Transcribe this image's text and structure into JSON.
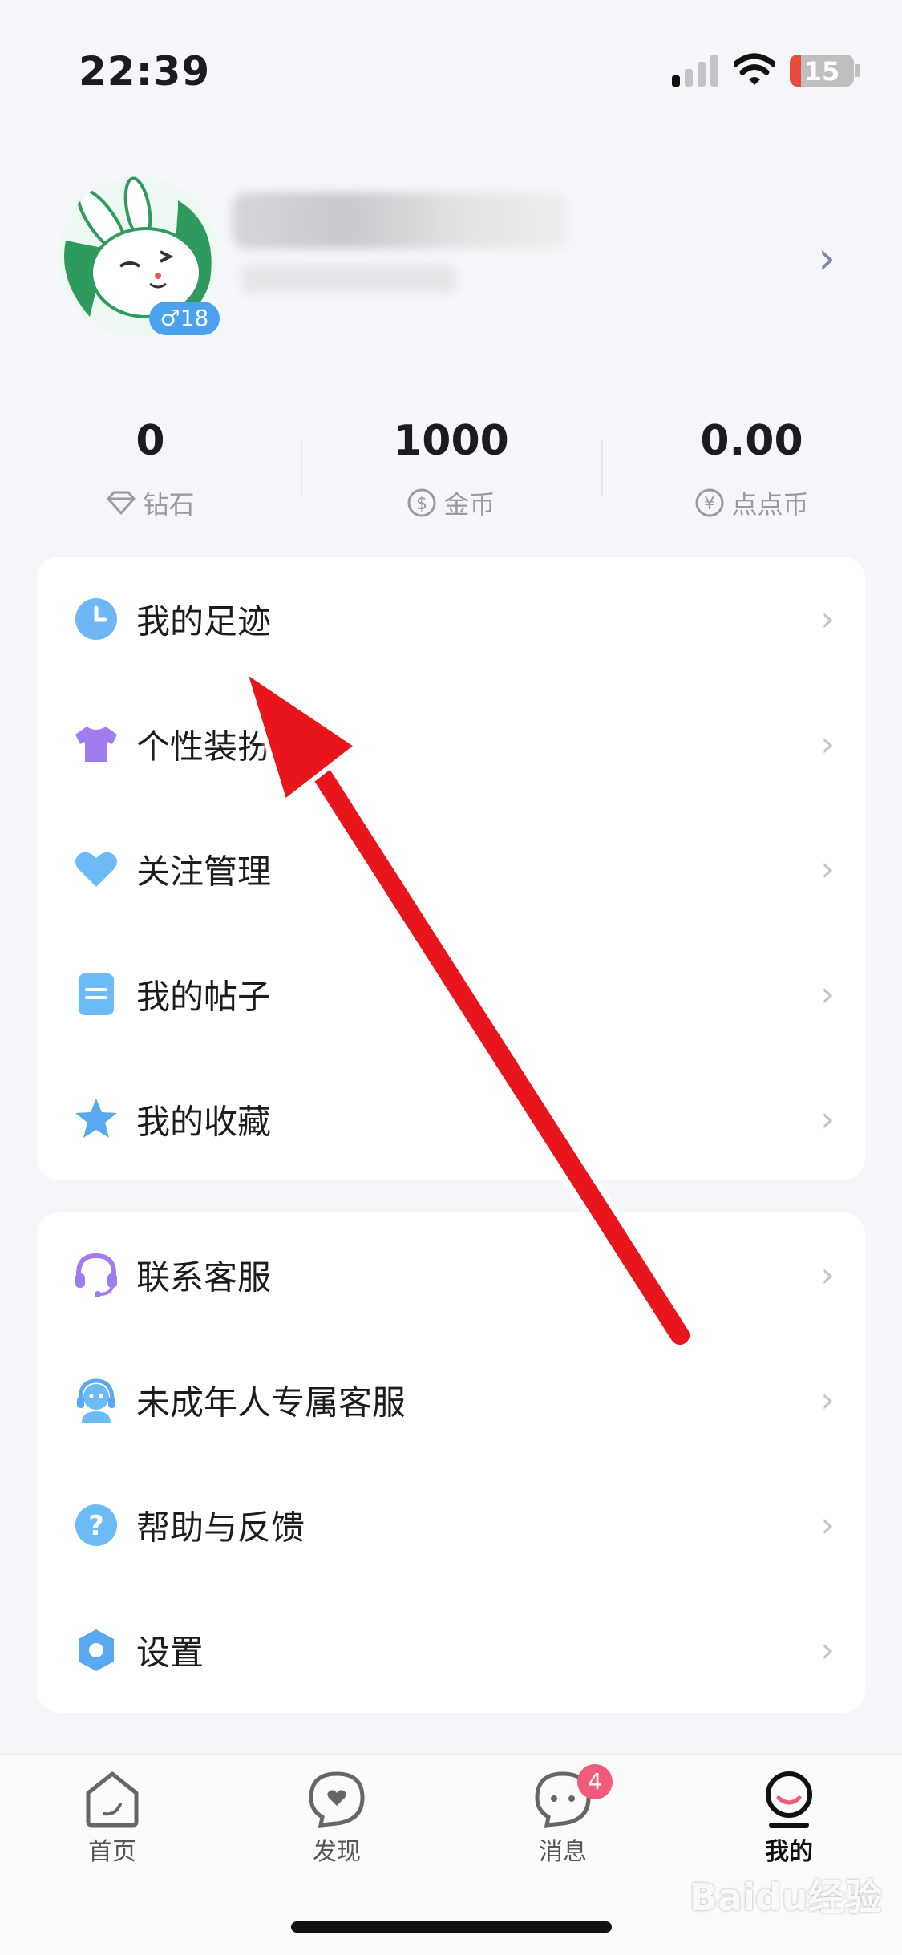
{
  "status_bar": {
    "time": "22:39",
    "battery": "15"
  },
  "profile": {
    "gender_age": "♂18"
  },
  "stats": [
    {
      "value": "0",
      "label": "钻石",
      "icon": "diamond-icon"
    },
    {
      "value": "1000",
      "label": "金币",
      "icon": "dollar-coin-icon"
    },
    {
      "value": "0.00",
      "label": "点点币",
      "icon": "yen-coin-icon"
    }
  ],
  "menu_primary": [
    {
      "label": "我的足迹",
      "icon": "clock-icon"
    },
    {
      "label": "个性装扮",
      "icon": "tshirt-icon"
    },
    {
      "label": "关注管理",
      "icon": "heart-icon"
    },
    {
      "label": "我的帖子",
      "icon": "document-icon"
    },
    {
      "label": "我的收藏",
      "icon": "star-icon"
    }
  ],
  "menu_secondary": [
    {
      "label": "联系客服",
      "icon": "headset-icon"
    },
    {
      "label": "未成年人专属客服",
      "icon": "support-agent-icon"
    },
    {
      "label": "帮助与反馈",
      "icon": "help-icon"
    },
    {
      "label": "设置",
      "icon": "settings-gear-icon"
    }
  ],
  "tabbar": {
    "tabs": [
      {
        "label": "首页",
        "icon": "home-icon"
      },
      {
        "label": "发现",
        "icon": "discover-icon"
      },
      {
        "label": "消息",
        "icon": "message-icon"
      },
      {
        "label": "我的",
        "icon": "profile-smile-icon"
      }
    ],
    "active_tab": "我的",
    "message_badge": "4"
  },
  "watermark": "Baidu经验",
  "colors": {
    "accent_blue": "#4aa2ee",
    "arrow_red": "#e8141b",
    "badge_pink": "#f25a7b"
  }
}
